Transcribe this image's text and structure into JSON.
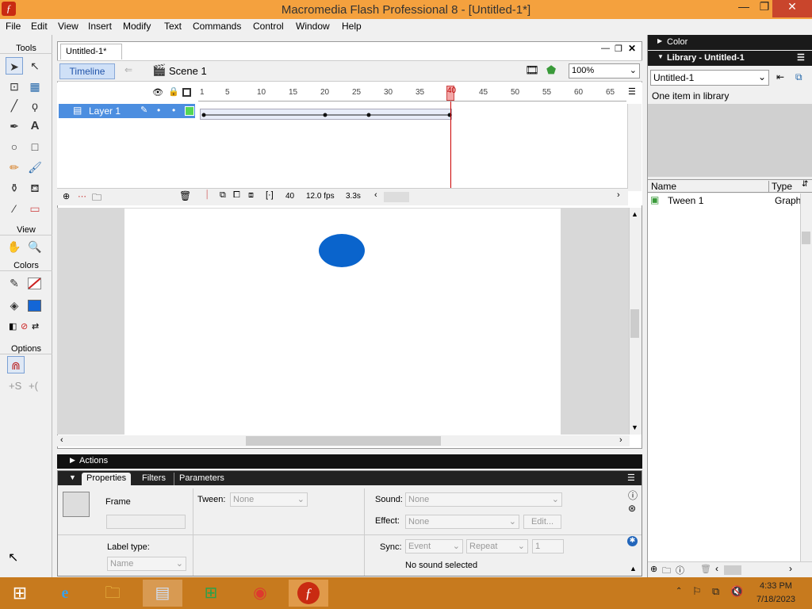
{
  "app": {
    "title": "Macromedia Flash Professional 8 - [Untitled-1*]"
  },
  "menu": [
    "File",
    "Edit",
    "View",
    "Insert",
    "Modify",
    "Text",
    "Commands",
    "Control",
    "Window",
    "Help"
  ],
  "tools": {
    "section_tools": "Tools",
    "section_view": "View",
    "section_colors": "Colors",
    "section_options": "Options",
    "stroke_color": "#cc2222",
    "fill_color": "#1466d6"
  },
  "document": {
    "tab": "Untitled-1*",
    "timeline_button": "Timeline",
    "scene": "Scene 1",
    "zoom": "100%"
  },
  "timeline": {
    "layer_name": "Layer 1",
    "frame_numbers": [
      "1",
      "5",
      "10",
      "15",
      "20",
      "25",
      "30",
      "35",
      "40",
      "45",
      "50",
      "55",
      "60",
      "65"
    ],
    "current_frame": "40",
    "fps": "12.0 fps",
    "elapsed": "3.3s"
  },
  "stage": {
    "shape_color": "#0a64cc"
  },
  "right": {
    "color_panel": "Color",
    "library_panel": "Library - Untitled-1",
    "library_select": "Untitled-1",
    "library_count": "One item in library",
    "col_name": "Name",
    "col_type": "Type",
    "item_name": "Tween 1",
    "item_type": "Graph"
  },
  "actions": {
    "label": "Actions"
  },
  "properties": {
    "tabs": [
      "Properties",
      "Filters",
      "Parameters"
    ],
    "frame_label": "Frame",
    "tween_label": "Tween:",
    "tween_value": "None",
    "sound_label": "Sound:",
    "sound_value": "None",
    "effect_label": "Effect:",
    "effect_value": "None",
    "edit_btn": "Edit...",
    "label_type": "Label type:",
    "label_type_value": "Name",
    "sync_label": "Sync:",
    "sync_value": "Event",
    "repeat_value": "Repeat",
    "repeat_count": "1",
    "no_sound": "No sound selected"
  },
  "taskbar": {
    "time": "4:33 PM",
    "date": "7/18/2023"
  }
}
